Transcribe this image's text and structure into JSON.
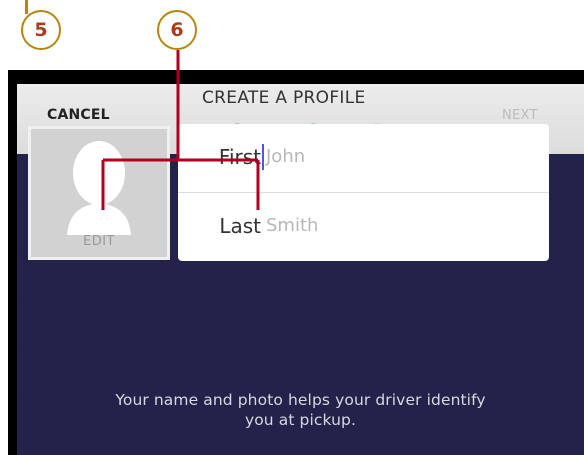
{
  "callouts": {
    "first": "5",
    "second": "6"
  },
  "header": {
    "cancel_label": "CANCEL",
    "title": "CREATE A PROFILE",
    "next_label": "NEXT",
    "progress": {
      "steps_total": 3,
      "steps_completed": 2
    }
  },
  "photo": {
    "edit_label": "EDIT"
  },
  "name_form": {
    "first": {
      "label": "First",
      "placeholder": "John"
    },
    "last": {
      "label": "Last",
      "placeholder": "Smith"
    }
  },
  "helper_text": {
    "line1": "Your name and photo helps your driver identify",
    "line2": "you at pickup."
  },
  "colors": {
    "accent_green": "#3cb14a",
    "callout_line": "#b00020",
    "background_navy": "#22224a",
    "caret_blue": "#4a5fd0"
  }
}
